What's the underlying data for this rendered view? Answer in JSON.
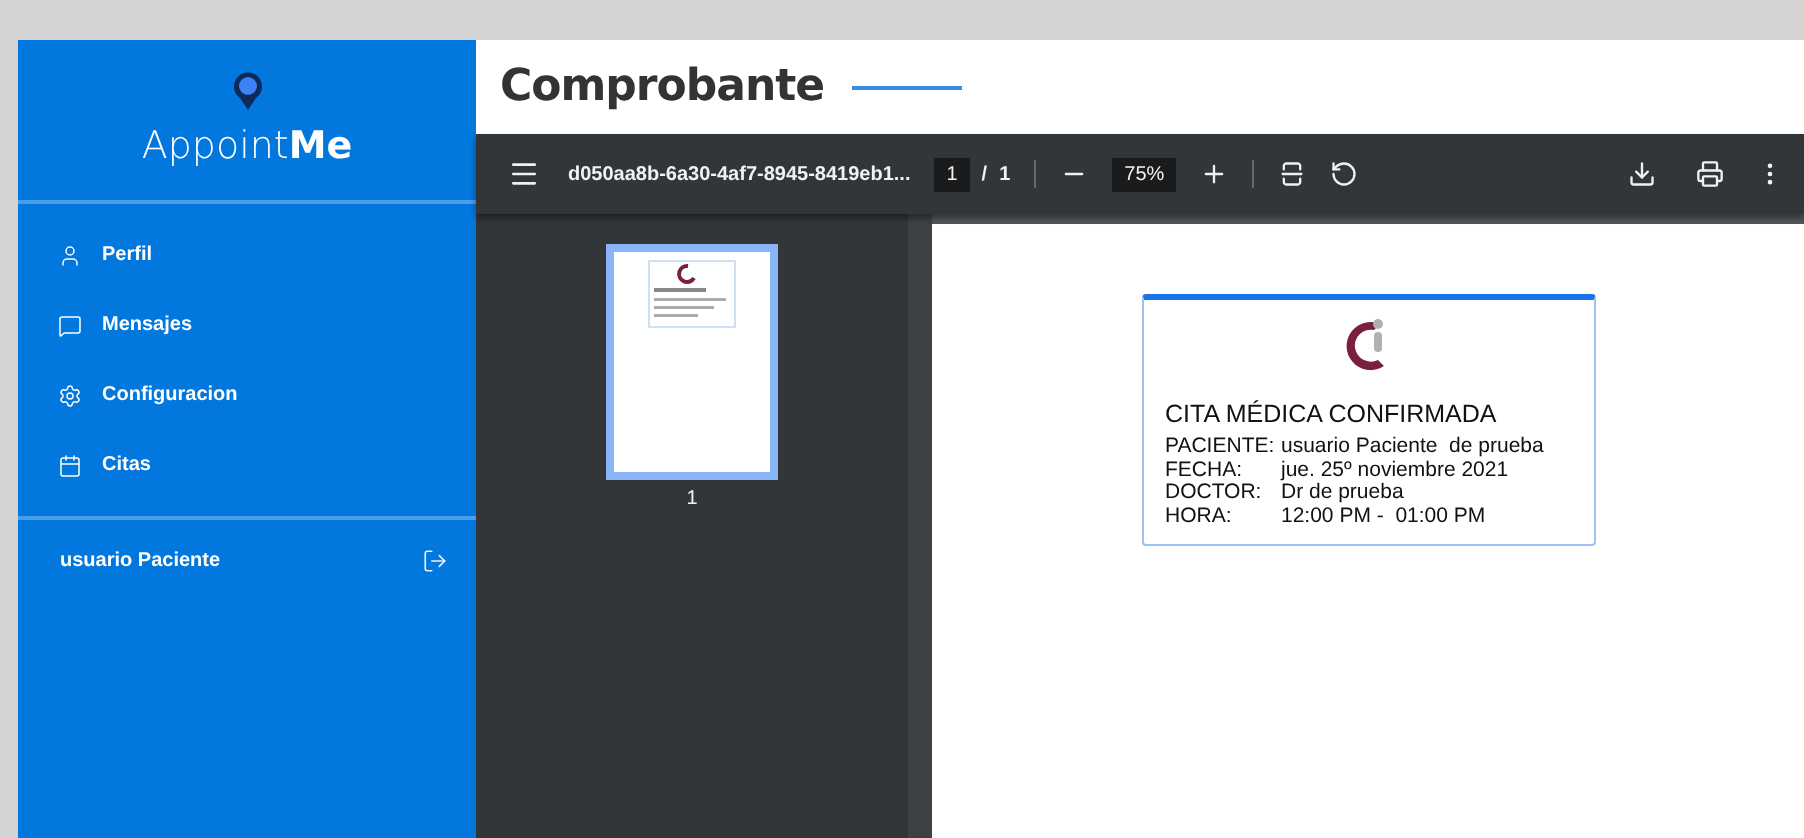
{
  "sidebar": {
    "app_name": "Appoint**Me**",
    "items": [
      {
        "label": "Perfil"
      },
      {
        "label": "Mensajes"
      },
      {
        "label": "Configuracion"
      },
      {
        "label": "Citas"
      }
    ],
    "user": {
      "name": "usuario Paciente"
    }
  },
  "header": {
    "title": "Comprobante"
  },
  "viewer": {
    "file_name": "d050aa8b-6a30-4af7-8945-8419eb1...",
    "page_current": "1",
    "page_separator": "/",
    "page_total": "1",
    "zoom": "75%",
    "thumbnails": [
      {
        "label": "1",
        "selected": true
      }
    ],
    "document": {
      "title": "CITA MÉDICA CONFIRMADA",
      "rows": [
        {
          "label": "PACIENTE:",
          "value": "usuario Paciente  de prueba"
        },
        {
          "label": "FECHA:",
          "value": "jue. 25º noviembre 2021"
        },
        {
          "label": "DOCTOR:",
          "value": "Dr de prueba"
        },
        {
          "label": "HORA:",
          "value": "12:00 PM -  01:00 PM"
        }
      ]
    }
  }
}
